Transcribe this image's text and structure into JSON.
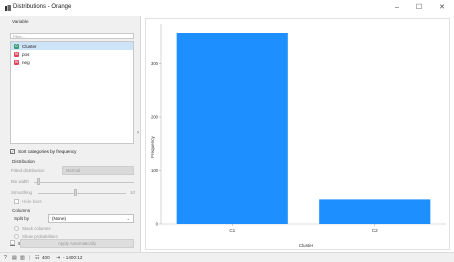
{
  "window": {
    "title": "Distributions - Orange",
    "minimize": "–",
    "maximize": "☐",
    "close": "✕"
  },
  "variable": {
    "group_title": "Variable",
    "filter_placeholder": "Filter...",
    "items": [
      {
        "name": "Cluster",
        "icon_letter": "C",
        "icon_color": "#3a9b6e"
      },
      {
        "name": "pos",
        "icon_letter": "N",
        "icon_color": "#e0455e"
      },
      {
        "name": "neg",
        "icon_letter": "N",
        "icon_color": "#e0455e"
      }
    ],
    "selected": "Cluster"
  },
  "sort_categories": {
    "label": "Sort categories by frequency",
    "checked": true
  },
  "distribution": {
    "group_title": "Distribution",
    "fitted_label": "Fitted distribution",
    "fitted_value": "Normal",
    "bin_width_label": "Bin width",
    "smoothing_label": "Smoothing",
    "smoothing_value": "10",
    "hide_bars_label": "Hide bars"
  },
  "columns": {
    "group_title": "Columns",
    "split_by_label": "Split by",
    "split_by_value": "(None)",
    "stack_columns_label": "Stack columns",
    "show_probabilities_label": "Show probabilities",
    "show_cumulative": {
      "label": "Show cumulative distribution",
      "checked": false
    }
  },
  "apply": {
    "label": "Apply Automatically",
    "auto_checked": false
  },
  "statusbar": {
    "data_count": "400",
    "output_count": "- 1400:12"
  },
  "colors": {
    "bar": "#1e8fff",
    "accent_select": "#cde3f7"
  },
  "chart_data": {
    "type": "bar",
    "categories": [
      "C1",
      "C2"
    ],
    "values": [
      357,
      46
    ],
    "xlabel": "Cluster",
    "ylabel": "Frequency",
    "yticks": [
      0,
      100,
      200,
      300
    ],
    "ylim": [
      0,
      357
    ]
  }
}
